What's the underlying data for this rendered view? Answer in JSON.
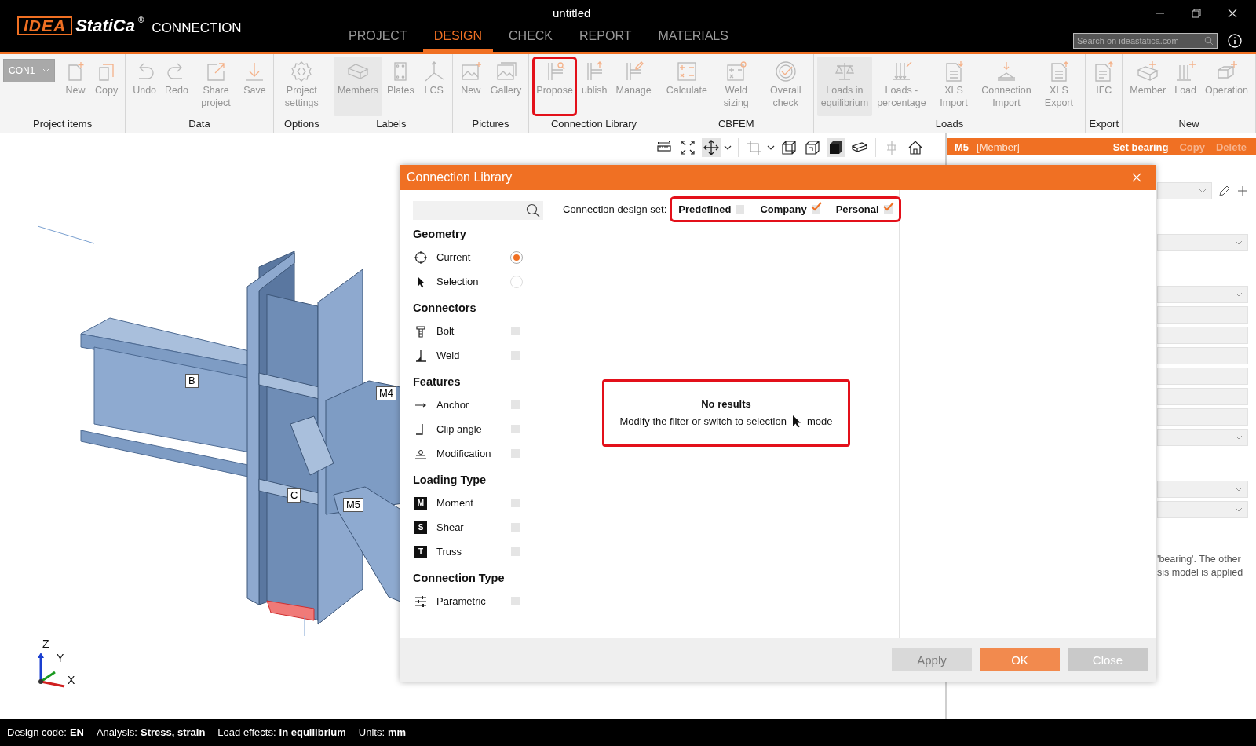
{
  "window": {
    "title": "untitled"
  },
  "logo": {
    "mark": "IDEA",
    "name": "StatiCa",
    "registered": "®",
    "product": "CONNECTION"
  },
  "tabs": [
    {
      "label": "PROJECT",
      "selected": false
    },
    {
      "label": "DESIGN",
      "selected": true
    },
    {
      "label": "CHECK",
      "selected": false
    },
    {
      "label": "REPORT",
      "selected": false
    },
    {
      "label": "MATERIALS",
      "selected": false
    }
  ],
  "search": {
    "placeholder": "Search on ideastatica.com"
  },
  "ribbon": {
    "project_selector": {
      "value": "CON1",
      "disabled": true
    },
    "groups": [
      {
        "label": "Project items",
        "buttons": [
          {
            "label": "New",
            "disabled": true,
            "selected": false,
            "highlighted": false
          },
          {
            "label": "Copy",
            "disabled": true,
            "selected": false,
            "highlighted": false
          }
        ]
      },
      {
        "label": "Data",
        "buttons": [
          {
            "label": "Undo",
            "disabled": true,
            "selected": false,
            "highlighted": false
          },
          {
            "label": "Redo",
            "disabled": true,
            "selected": false,
            "highlighted": false
          },
          {
            "label": "Share project",
            "disabled": true,
            "selected": false,
            "highlighted": false
          },
          {
            "label": "Save",
            "disabled": true,
            "selected": false,
            "highlighted": false
          }
        ]
      },
      {
        "label": "Options",
        "buttons": [
          {
            "label": "Project settings",
            "disabled": true,
            "selected": false,
            "highlighted": false
          }
        ]
      },
      {
        "label": "Labels",
        "buttons": [
          {
            "label": "Members",
            "disabled": true,
            "selected": true,
            "highlighted": false
          },
          {
            "label": "Plates",
            "disabled": true,
            "selected": false,
            "highlighted": false
          },
          {
            "label": "LCS",
            "disabled": true,
            "selected": false,
            "highlighted": false
          }
        ]
      },
      {
        "label": "Pictures",
        "buttons": [
          {
            "label": "New",
            "disabled": true,
            "selected": false,
            "highlighted": false
          },
          {
            "label": "Gallery",
            "disabled": true,
            "selected": false,
            "highlighted": false
          }
        ]
      },
      {
        "label": "Connection Library",
        "buttons": [
          {
            "label": "Propose",
            "disabled": true,
            "selected": false,
            "highlighted": true
          },
          {
            "label": "ublish",
            "disabled": true,
            "selected": false,
            "highlighted": false
          },
          {
            "label": "Manage",
            "disabled": true,
            "selected": false,
            "highlighted": false
          }
        ]
      },
      {
        "label": "CBFEM",
        "buttons": [
          {
            "label": "Calculate",
            "disabled": true,
            "selected": false,
            "highlighted": false
          },
          {
            "label": "Weld sizing",
            "disabled": true,
            "selected": false,
            "highlighted": false
          },
          {
            "label": "Overall check",
            "disabled": true,
            "selected": false,
            "highlighted": false
          }
        ]
      },
      {
        "label": "Loads",
        "buttons": [
          {
            "label": "Loads in equilibrium",
            "disabled": true,
            "selected": true,
            "highlighted": false
          },
          {
            "label": "Loads - percentage",
            "disabled": true,
            "selected": false,
            "highlighted": false
          },
          {
            "label": "XLS Import",
            "disabled": true,
            "selected": false,
            "highlighted": false
          },
          {
            "label": "Connection Import",
            "disabled": true,
            "selected": false,
            "highlighted": false
          },
          {
            "label": "XLS Export",
            "disabled": true,
            "selected": false,
            "highlighted": false
          }
        ]
      },
      {
        "label": "Export",
        "buttons": [
          {
            "label": "IFC",
            "disabled": true,
            "selected": false,
            "highlighted": false
          }
        ]
      },
      {
        "label": "New",
        "buttons": [
          {
            "label": "Member",
            "disabled": true,
            "selected": false,
            "highlighted": false
          },
          {
            "label": "Load",
            "disabled": true,
            "selected": false,
            "highlighted": false
          },
          {
            "label": "Operation",
            "disabled": true,
            "selected": false,
            "highlighted": false
          }
        ]
      }
    ]
  },
  "viewport_toolbar": [
    {
      "selected": false,
      "menu": false
    },
    {
      "selected": false,
      "menu": false
    },
    {
      "selected": true,
      "menu": true
    },
    {
      "selected": false,
      "menu": true
    },
    {
      "selected": false,
      "menu": false
    },
    {
      "selected": false,
      "menu": false
    },
    {
      "selected": true,
      "menu": false
    },
    {
      "selected": false,
      "menu": false
    },
    {
      "selected": false,
      "menu": false
    },
    {
      "selected": false,
      "menu": false
    }
  ],
  "viewport": {
    "member_labels": [
      "B",
      "C",
      "M4",
      "M5"
    ],
    "axes": [
      "Z",
      "Y",
      "X"
    ]
  },
  "properties_panel": {
    "member": "M5",
    "type": "[Member]",
    "actions": [
      {
        "label": "Set bearing",
        "disabled": false
      },
      {
        "label": "Copy",
        "disabled": true
      },
      {
        "label": "Delete",
        "disabled": true
      }
    ],
    "fields": [
      {
        "kind": "dropdown-edit"
      },
      {
        "kind": "spacer"
      },
      {
        "kind": "dropdown"
      },
      {
        "kind": "spacer"
      },
      {
        "kind": "dropdown"
      },
      {
        "kind": "input"
      },
      {
        "kind": "input"
      },
      {
        "kind": "input"
      },
      {
        "kind": "input"
      },
      {
        "kind": "input"
      },
      {
        "kind": "input"
      },
      {
        "kind": "dropdown"
      },
      {
        "kind": "spacer"
      },
      {
        "kind": "dropdown"
      },
      {
        "kind": "dropdown"
      }
    ],
    "note": [
      "'bearing'. The other",
      "sis model is applied"
    ]
  },
  "dialog": {
    "title": "Connection Library",
    "sections": [
      {
        "title": "Geometry",
        "items": [
          {
            "label": "Current",
            "kind": "radio",
            "selected": true
          },
          {
            "label": "Selection",
            "kind": "radio",
            "selected": false
          }
        ]
      },
      {
        "title": "Connectors",
        "items": [
          {
            "label": "Bolt",
            "kind": "check",
            "checked": false
          },
          {
            "label": "Weld",
            "kind": "check",
            "checked": false
          }
        ]
      },
      {
        "title": "Features",
        "items": [
          {
            "label": "Anchor",
            "kind": "check",
            "checked": false
          },
          {
            "label": "Clip angle",
            "kind": "check",
            "checked": false
          },
          {
            "label": "Modification",
            "kind": "check",
            "checked": false
          }
        ]
      },
      {
        "title": "Loading Type",
        "items": [
          {
            "label": "Moment",
            "badge": "M",
            "kind": "check",
            "checked": false
          },
          {
            "label": "Shear",
            "badge": "S",
            "kind": "check",
            "checked": false
          },
          {
            "label": "Truss",
            "badge": "T",
            "kind": "check",
            "checked": false
          }
        ]
      },
      {
        "title": "Connection Type",
        "items": [
          {
            "label": "Parametric",
            "kind": "check",
            "checked": false
          }
        ]
      }
    ],
    "design_set": {
      "label": "Connection design set:",
      "highlighted": true,
      "options": [
        {
          "label": "Predefined",
          "checked": false
        },
        {
          "label": "Company",
          "checked": true
        },
        {
          "label": "Personal",
          "checked": true
        }
      ]
    },
    "message": {
      "title": "No results",
      "text": "Modify the filter or switch to selection",
      "suffix": "mode",
      "highlighted": true
    },
    "buttons": [
      {
        "label": "Apply",
        "kind": "default",
        "disabled": true
      },
      {
        "label": "OK",
        "kind": "primary",
        "disabled": false
      },
      {
        "label": "Close",
        "kind": "default",
        "disabled": false
      }
    ]
  },
  "status_bar": [
    {
      "label": "Design code:",
      "value": "EN"
    },
    {
      "label": "Analysis:",
      "value": "Stress, strain"
    },
    {
      "label": "Load effects:",
      "value": "In equilibrium"
    },
    {
      "label": "Units:",
      "value": "mm"
    }
  ]
}
